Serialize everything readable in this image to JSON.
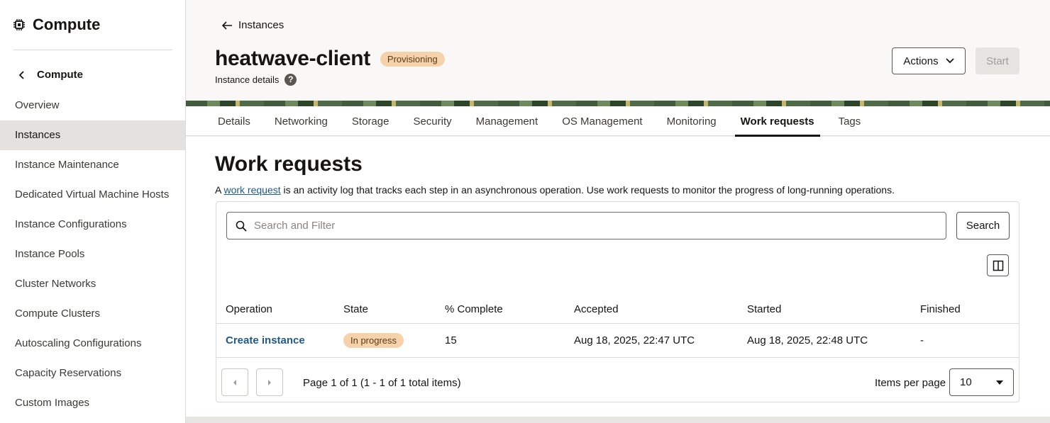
{
  "sidebar": {
    "brand_title": "Compute",
    "back_label": "Compute",
    "items": [
      {
        "label": "Overview",
        "active": false
      },
      {
        "label": "Instances",
        "active": true
      },
      {
        "label": "Instance Maintenance",
        "active": false
      },
      {
        "label": "Dedicated Virtual Machine Hosts",
        "active": false
      },
      {
        "label": "Instance Configurations",
        "active": false
      },
      {
        "label": "Instance Pools",
        "active": false
      },
      {
        "label": "Cluster Networks",
        "active": false
      },
      {
        "label": "Compute Clusters",
        "active": false
      },
      {
        "label": "Autoscaling Configurations",
        "active": false
      },
      {
        "label": "Capacity Reservations",
        "active": false
      },
      {
        "label": "Custom Images",
        "active": false
      }
    ]
  },
  "header": {
    "breadcrumb": "Instances",
    "title": "heatwave-client",
    "status": "Provisioning",
    "subtitle": "Instance details",
    "actions_label": "Actions",
    "start_label": "Start"
  },
  "tabs": [
    "Details",
    "Networking",
    "Storage",
    "Security",
    "Management",
    "OS Management",
    "Monitoring",
    "Work requests",
    "Tags"
  ],
  "active_tab": "Work requests",
  "main": {
    "title": "Work requests",
    "desc_prefix": "A ",
    "desc_link": "work request",
    "desc_suffix": " is an activity log that tracks each step in an asynchronous operation. Use work requests to monitor the progress of long-running operations.",
    "search_placeholder": "Search and Filter",
    "search_button": "Search",
    "columns": [
      "Operation",
      "State",
      "% Complete",
      "Accepted",
      "Started",
      "Finished"
    ],
    "rows": [
      {
        "operation": "Create instance",
        "state": "In progress",
        "percent": "15",
        "accepted": "Aug 18, 2025, 22:47 UTC",
        "started": "Aug 18, 2025, 22:48 UTC",
        "finished": "-"
      }
    ],
    "page_info": "Page 1 of 1 (1 - 1 of 1 total items)",
    "items_per_page_label": "Items per page",
    "items_per_page_value": "10"
  },
  "colors": {
    "accent_link": "#1e5a8a",
    "status_badge_bg": "#f5d2aa",
    "active_nav_bg": "#e4e1de"
  }
}
